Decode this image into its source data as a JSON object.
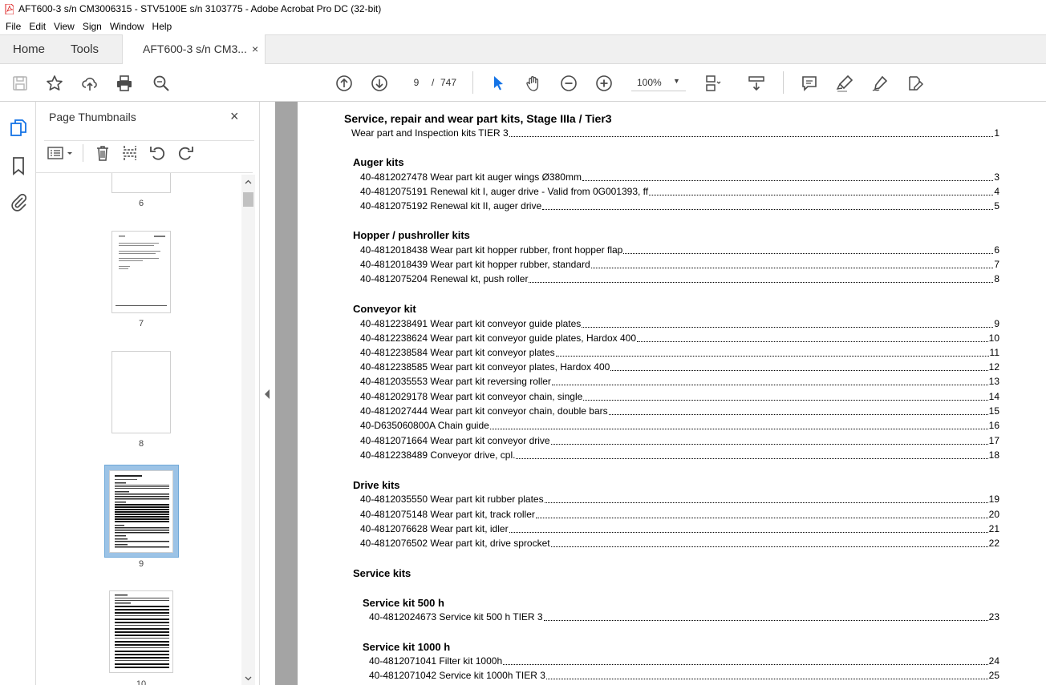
{
  "window": {
    "title": "AFT600-3 s/n CM3006315 - STV5100E s/n 3103775 - Adobe Acrobat Pro DC (32-bit)"
  },
  "menu": [
    "File",
    "Edit",
    "View",
    "Sign",
    "Window",
    "Help"
  ],
  "tabs": {
    "home": "Home",
    "tools": "Tools",
    "document": "AFT600-3 s/n CM3...",
    "close": "×"
  },
  "toolbar": {
    "current_page": "9",
    "page_separator": "/",
    "total_pages": "747",
    "zoom": "100%",
    "icons": [
      "save-icon",
      "star-icon",
      "upload-icon",
      "print-icon",
      "search-zoom-icon",
      "page-up-icon",
      "page-down-icon",
      "select-cursor-icon",
      "hand-icon",
      "zoom-out-icon",
      "zoom-in-icon",
      "fit-page-icon",
      "scroll-mode-icon",
      "comment-icon",
      "highlight-icon",
      "sign-icon",
      "edit-icon"
    ]
  },
  "sidebar": {
    "title": "Page Thumbnails",
    "close": "×",
    "thumbnails": [
      "6",
      "7",
      "8",
      "9",
      "10"
    ],
    "selected": "9"
  },
  "document": {
    "title": "Service, repair and wear part kits, Stage IIIa / Tier3",
    "intro": {
      "text": "Wear part and Inspection kits TIER 3",
      "page": "1"
    },
    "sections": [
      {
        "heading": "Auger kits",
        "entries": [
          {
            "text": "40-4812027478 Wear part kit auger wings Ø380mm",
            "page": "3"
          },
          {
            "text": "40-4812075191 Renewal kit I, auger drive - Valid from 0G001393, ff",
            "page": "4"
          },
          {
            "text": "40-4812075192 Renewal kit II, auger drive",
            "page": "5"
          }
        ]
      },
      {
        "heading": "Hopper / pushroller kits",
        "entries": [
          {
            "text": "40-4812018438 Wear part kit hopper rubber, front hopper flap",
            "page": "6"
          },
          {
            "text": "40-4812018439 Wear part kit hopper rubber, standard",
            "page": "7"
          },
          {
            "text": "40-4812075204 Renewal kt, push roller",
            "page": "8"
          }
        ]
      },
      {
        "heading": "Conveyor kit",
        "entries": [
          {
            "text": "40-4812238491 Wear part kit conveyor guide plates",
            "page": "9"
          },
          {
            "text": "40-4812238624 Wear part kit conveyor guide plates, Hardox 400",
            "page": "10"
          },
          {
            "text": "40-4812238584 Wear part kit conveyor plates",
            "page": "11"
          },
          {
            "text": "40-4812238585 Wear part kit conveyor plates, Hardox 400",
            "page": "12"
          },
          {
            "text": "40-4812035553 Wear part kit reversing roller",
            "page": "13"
          },
          {
            "text": "40-4812029178 Wear part kit conveyor chain, single",
            "page": "14"
          },
          {
            "text": "40-4812027444 Wear part kit conveyor chain, double bars",
            "page": "15"
          },
          {
            "text": "40-D635060800A Chain guide",
            "page": "16"
          },
          {
            "text": "40-4812071664 Wear part kit conveyor drive",
            "page": "17"
          },
          {
            "text": "40-4812238489 Conveyor drive, cpl.",
            "page": "18"
          }
        ]
      },
      {
        "heading": "Drive kits",
        "entries": [
          {
            "text": "40-4812035550 Wear part kit rubber plates",
            "page": "19"
          },
          {
            "text": "40-4812075148 Wear part kit, track roller",
            "page": "20"
          },
          {
            "text": "40-4812076628 Wear part kit, idler",
            "page": "21"
          },
          {
            "text": "40-4812076502 Wear part kit, drive sprocket",
            "page": "22"
          }
        ]
      }
    ],
    "service_heading": "Service kits",
    "service_500": {
      "heading": "Service kit 500 h",
      "entries": [
        {
          "text": "40-4812024673 Service kit 500 h TIER 3",
          "page": "23"
        }
      ]
    },
    "service_1000": {
      "heading": "Service kit 1000 h",
      "entries": [
        {
          "text": "40-4812071041 Filter kit 1000h",
          "page": "24"
        },
        {
          "text": "40-4812071042 Service kit 1000h TIER 3",
          "page": "25"
        }
      ]
    }
  },
  "colors": {
    "accent_blue": "#1473e6",
    "toolbar_icon": "#4b4b4b",
    "doc_background": "#a4a4a4",
    "selected_thumb": "#9cc3e6"
  }
}
